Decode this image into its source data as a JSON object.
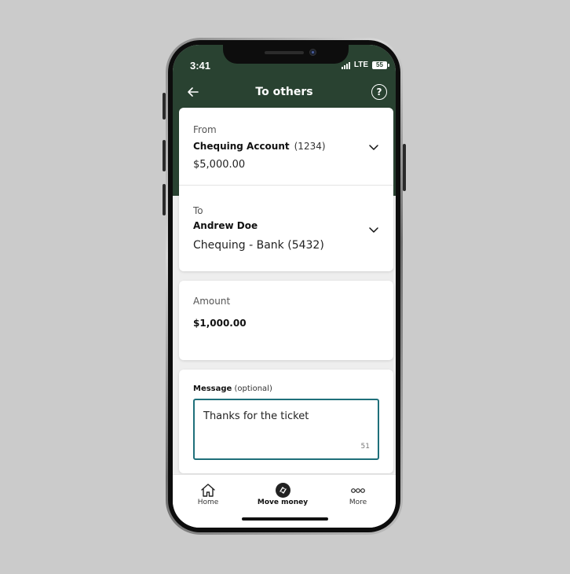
{
  "status_bar": {
    "time": "3:41",
    "network": "LTE",
    "battery": "55"
  },
  "header": {
    "title": "To others",
    "back_icon": "arrow-left-icon",
    "help_icon": "question-circle-icon"
  },
  "from": {
    "label": "From",
    "account_name": "Chequing Account",
    "account_number": "(1234)",
    "balance": "$5,000.00"
  },
  "to": {
    "label": "To",
    "recipient_name": "Andrew Doe",
    "recipient_account": "Chequing - Bank (5432)"
  },
  "amount": {
    "label": "Amount",
    "value": "$1,000.00"
  },
  "message": {
    "label": "Message",
    "label_suffix": "(optional)",
    "value": "Thanks for the ticket",
    "remaining_chars": "51"
  },
  "tabbar": {
    "items": [
      {
        "label": "Home",
        "icon": "home-icon"
      },
      {
        "label": "Move money",
        "icon": "transfer-icon",
        "active": true
      },
      {
        "label": "More",
        "icon": "more-dots-icon"
      }
    ]
  },
  "colors": {
    "header_bg": "#294231",
    "accent": "#1f6f7a",
    "page_bg": "#cbcbcb"
  }
}
